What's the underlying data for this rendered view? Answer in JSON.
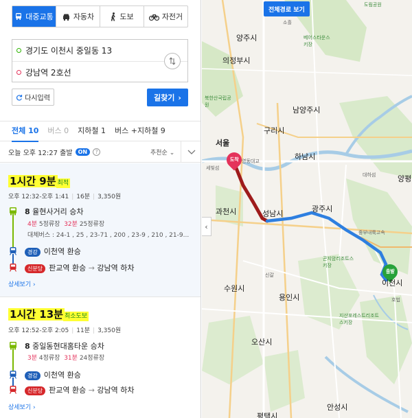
{
  "modes": [
    {
      "label": "대중교통",
      "icon": "bus-icon",
      "active": true
    },
    {
      "label": "자동차",
      "icon": "car-icon",
      "active": false
    },
    {
      "label": "도보",
      "icon": "walk-icon",
      "active": false
    },
    {
      "label": "자전거",
      "icon": "bicycle-icon",
      "active": false
    }
  ],
  "origin": "경기도 이천시 중일동 13",
  "destination": "강남역 2호선",
  "buttons": {
    "reset": "다시입력",
    "search": "길찾기"
  },
  "tabs": [
    {
      "label": "전체 10",
      "state": "active"
    },
    {
      "label": "버스 0",
      "state": "dim"
    },
    {
      "label": "지하철 1",
      "state": "normal"
    },
    {
      "label": "버스 +지하철 9",
      "state": "normal"
    }
  ],
  "departure": {
    "text": "오늘 오후 12:27 출발",
    "toggle": "ON",
    "help": "?",
    "sort": "추천순"
  },
  "routes": [
    {
      "duration": "1시간 9분",
      "tag": "최적",
      "time_range": "오후 12:32-오후 1:41",
      "transfers": "16분",
      "fare": "3,350원",
      "bus_number": "8",
      "bus_board": "율현사거리 승차",
      "bus_arrival_a": "4분",
      "bus_stops_a": "5정류장",
      "bus_arrival_b": "32분",
      "bus_stops_b": "25정류장",
      "alt_buses": "대체버스 : 24-1 , 25 , 23-71 , 200 , 23-9 , 210 , 21-9...",
      "line1_badge": "경강",
      "line1_text": "이천역 환승",
      "line2_badge": "신분당",
      "line2_from": "판교역 환승",
      "line2_arrow": "→",
      "line2_to": "강남역 하차",
      "detail": "상세보기"
    },
    {
      "duration": "1시간 13분",
      "tag": "최소도보",
      "time_range": "오후 12:52-오후 2:05",
      "transfers": "11분",
      "fare": "3,350원",
      "bus_number": "8",
      "bus_board": "중일동현대홈타운 승차",
      "bus_arrival_a": "3분",
      "bus_stops_a": "4정류장",
      "bus_arrival_b": "31분",
      "bus_stops_b": "24정류장",
      "line1_badge": "경강",
      "line1_text": "이천역 환승",
      "line2_badge": "신분당",
      "line2_from": "판교역 환승",
      "line2_arrow": "→",
      "line2_to": "강남역 하차",
      "detail": "상세보기"
    }
  ],
  "map": {
    "overview_button": "전체경로 보기",
    "collapse": "‹",
    "arrival_pin": "도착",
    "departure_pin": "출발",
    "labels": [
      {
        "text": "양주시",
        "kind": "big"
      },
      {
        "text": "의정부시",
        "kind": "big"
      },
      {
        "text": "남양주시",
        "kind": "big"
      },
      {
        "text": "구리시",
        "kind": "big"
      },
      {
        "text": "서울",
        "kind": "big"
      },
      {
        "text": "하남시",
        "kind": "big"
      },
      {
        "text": "과천시",
        "kind": "big"
      },
      {
        "text": "성남시",
        "kind": "big"
      },
      {
        "text": "광주시",
        "kind": "big"
      },
      {
        "text": "수원시",
        "kind": "big"
      },
      {
        "text": "용인시",
        "kind": "big"
      },
      {
        "text": "오산시",
        "kind": "big"
      },
      {
        "text": "양평",
        "kind": "big"
      },
      {
        "text": "이천시",
        "kind": "big"
      },
      {
        "text": "안성시",
        "kind": "big"
      },
      {
        "text": "평택시",
        "kind": "big"
      },
      {
        "text": "북한산국립공원",
        "kind": "green"
      },
      {
        "text": "베어스타운스키장",
        "kind": "green"
      },
      {
        "text": "곤지암리조트스키장",
        "kind": "green"
      },
      {
        "text": "지산포레스트리조트스키장",
        "kind": "green"
      },
      {
        "text": "도림공원",
        "kind": "green"
      },
      {
        "text": "세빛섬",
        "kind": "small"
      },
      {
        "text": "영동대교",
        "kind": "small"
      },
      {
        "text": "호법",
        "kind": "small"
      },
      {
        "text": "신갈",
        "kind": "small"
      },
      {
        "text": "소흘",
        "kind": "small"
      },
      {
        "text": "대하섬",
        "kind": "small"
      },
      {
        "text": "중부내륙고속",
        "kind": "small"
      }
    ]
  },
  "colors": {
    "accent": "#1a73e8",
    "highlight": "#ffff33",
    "bus_green": "#7ab800",
    "ktx_red": "#d6282b"
  }
}
